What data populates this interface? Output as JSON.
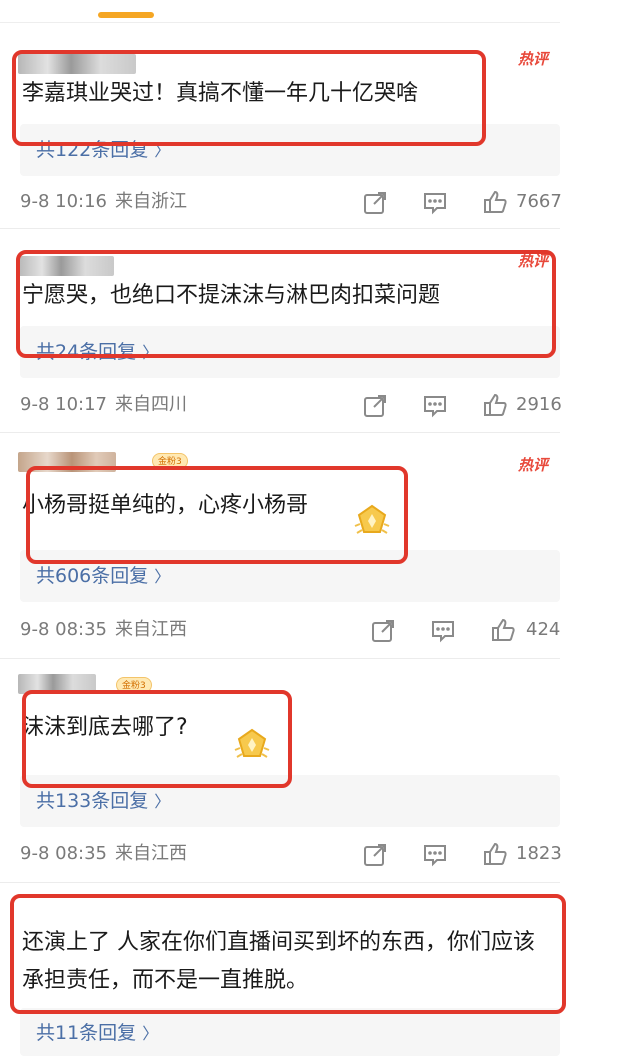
{
  "comments": [
    {
      "hot_label": "热评",
      "text": "李嘉琪业哭过！真搞不懂一年几十亿哭啥",
      "replies": "共122条回复",
      "date": "9-8 10:16",
      "location": "来自浙江",
      "likes": "7667"
    },
    {
      "hot_label": "热评",
      "text": "宁愿哭，也绝口不提沫沫与淋巴肉扣菜问题",
      "replies": "共24条回复",
      "date": "9-8 10:17",
      "location": "来自四川",
      "likes": "2916"
    },
    {
      "hot_label": "热评",
      "badge": "金粉3",
      "text": "小杨哥挺单纯的，心疼小杨哥",
      "replies": "共606条回复",
      "date": "9-8 08:35",
      "location": "来自江西",
      "likes": "424"
    },
    {
      "badge": "金粉3",
      "text": "沫沫到底去哪了?",
      "replies": "共133条回复",
      "date": "9-8 08:35",
      "location": "来自江西",
      "likes": "1823"
    },
    {
      "text": "还演上了  人家在你们直播间买到坏的东西，你们应该承担责任，而不是一直推脱。",
      "replies": "共11条回复"
    }
  ],
  "colors": {
    "highlight_border": "#e1372b",
    "hot_label": "#e8493b",
    "reply_link": "#4b6fa6",
    "tab_indicator": "#f5a623"
  },
  "icons": [
    "share-icon",
    "comment-icon",
    "like-icon",
    "medal-icon",
    "chevron-right-icon"
  ]
}
